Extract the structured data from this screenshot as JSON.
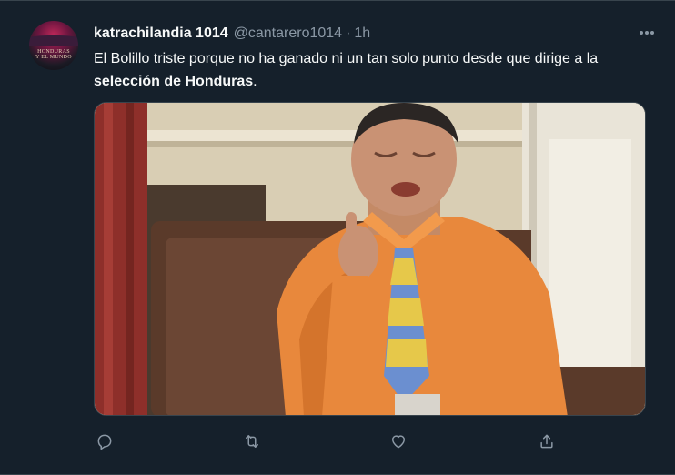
{
  "tweet": {
    "display_name": "katrachilandia 1014",
    "handle": "@cantarero1014",
    "separator": "·",
    "time": "1h",
    "avatar_text_line1": "HONDURAS",
    "avatar_text_line2": "Y EL MUNDO",
    "text_part1": "El Bolillo triste porque no ha ganado ni un tan solo punto desde que dirige a la ",
    "text_bold": "selección de Honduras",
    "text_part2": "."
  },
  "actions": {
    "reply_icon": "reply-icon",
    "retweet_icon": "retweet-icon",
    "like_icon": "heart-icon",
    "share_icon": "share-icon"
  },
  "colors": {
    "background": "#15202b",
    "text": "#f7f9f9",
    "muted": "#8b98a5",
    "border": "#38444d"
  }
}
